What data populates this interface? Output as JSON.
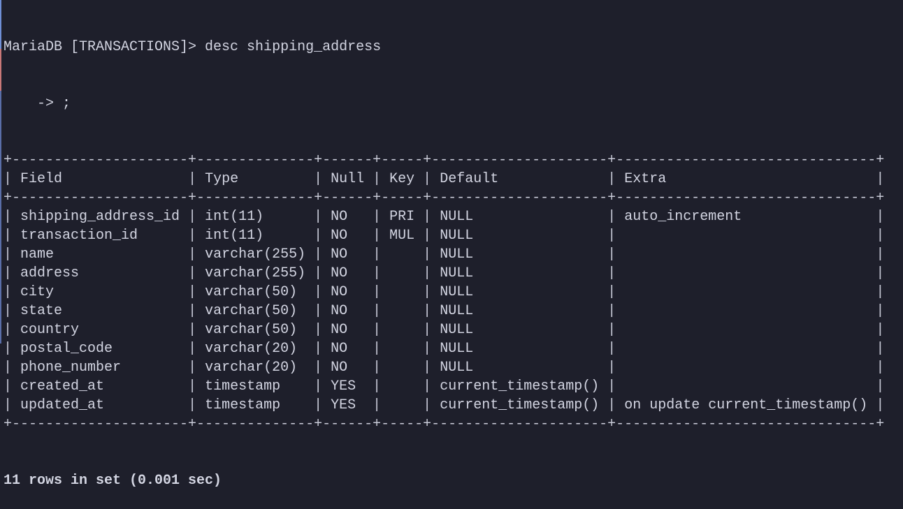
{
  "prompt": "MariaDB [TRANSACTIONS]> desc shipping_address",
  "continuation": "    -> ;",
  "table": {
    "columns": [
      "Field",
      "Type",
      "Null",
      "Key",
      "Default",
      "Extra"
    ],
    "rows": [
      [
        "shipping_address_id",
        "int(11)",
        "NO",
        "PRI",
        "NULL",
        "auto_increment"
      ],
      [
        "transaction_id",
        "int(11)",
        "NO",
        "MUL",
        "NULL",
        ""
      ],
      [
        "name",
        "varchar(255)",
        "NO",
        "",
        "NULL",
        ""
      ],
      [
        "address",
        "varchar(255)",
        "NO",
        "",
        "NULL",
        ""
      ],
      [
        "city",
        "varchar(50)",
        "NO",
        "",
        "NULL",
        ""
      ],
      [
        "state",
        "varchar(50)",
        "NO",
        "",
        "NULL",
        ""
      ],
      [
        "country",
        "varchar(50)",
        "NO",
        "",
        "NULL",
        ""
      ],
      [
        "postal_code",
        "varchar(20)",
        "NO",
        "",
        "NULL",
        ""
      ],
      [
        "phone_number",
        "varchar(20)",
        "NO",
        "",
        "NULL",
        ""
      ],
      [
        "created_at",
        "timestamp",
        "YES",
        "",
        "current_timestamp()",
        ""
      ],
      [
        "updated_at",
        "timestamp",
        "YES",
        "",
        "current_timestamp()",
        "on update current_timestamp()"
      ]
    ]
  },
  "footer": "11 rows in set (0.001 sec)",
  "colors": {
    "background": "#1e1f2b",
    "text": "#d3d5e2",
    "gutter_blue": "#6f8fd6",
    "gutter_red": "#d47a7a"
  }
}
